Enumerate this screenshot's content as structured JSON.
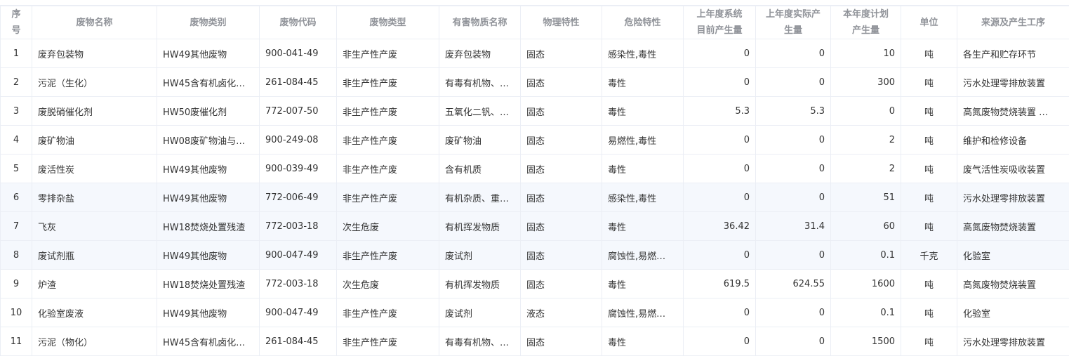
{
  "table": {
    "columns": [
      "序\n号",
      "废物名称",
      "废物类别",
      "废物代码",
      "废物类型",
      "有害物质名称",
      "物理特性",
      "危险特性",
      "上年度系统\n目前产生量",
      "上年度实际产\n生量",
      "本年度计划\n产生量",
      "单位",
      "来源及产生工序"
    ],
    "rows": [
      [
        "1",
        "废弃包装物",
        "HW49其他废物",
        "900-041-49",
        "非生产性产废",
        "废弃包装物",
        "固态",
        "感染性,毒性",
        "0",
        "0",
        "10",
        "吨",
        "各生产和贮存环节"
      ],
      [
        "2",
        "污泥（生化）",
        "HW45含有机卤化…",
        "261-084-45",
        "非生产性产废",
        "有毒有机物、…",
        "固态",
        "毒性",
        "0",
        "0",
        "300",
        "吨",
        "污水处理零排放装置"
      ],
      [
        "3",
        "废脱硝催化剂",
        "HW50废催化剂",
        "772-007-50",
        "非生产性产废",
        "五氧化二钒、…",
        "固态",
        "毒性",
        "5.3",
        "5.3",
        "0",
        "吨",
        "高氮废物焚烧装置 …"
      ],
      [
        "4",
        "废矿物油",
        "HW08废矿物油与…",
        "900-249-08",
        "非生产性产废",
        "废矿物油",
        "固态",
        "易燃性,毒性",
        "0",
        "0",
        "2",
        "吨",
        "维护和检修设备"
      ],
      [
        "5",
        "废活性炭",
        "HW49其他废物",
        "900-039-49",
        "非生产性产废",
        "含有机质",
        "固态",
        "毒性",
        "0",
        "0",
        "2",
        "吨",
        "废气活性炭吸收装置"
      ],
      [
        "6",
        "零排杂盐",
        "HW49其他废物",
        "772-006-49",
        "非生产性产废",
        "有机杂质、重…",
        "固态",
        "感染性,毒性",
        "0",
        "0",
        "51",
        "吨",
        "污水处理零排放装置"
      ],
      [
        "7",
        "飞灰",
        "HW18焚烧处置残渣",
        "772-003-18",
        "次生危废",
        "有机挥发物质",
        "固态",
        "毒性",
        "36.42",
        "31.4",
        "60",
        "吨",
        "高氮废物焚烧装置"
      ],
      [
        "8",
        "废试剂瓶",
        "HW49其他废物",
        "900-047-49",
        "非生产性产废",
        "废试剂",
        "固态",
        "腐蚀性,易燃…",
        "0",
        "0",
        "0.1",
        "千克",
        "化验室"
      ],
      [
        "9",
        "炉渣",
        "HW18焚烧处置残渣",
        "772-003-18",
        "次生危废",
        "有机挥发物质",
        "固态",
        "毒性",
        "619.5",
        "624.55",
        "1600",
        "吨",
        "高氮废物焚烧装置"
      ],
      [
        "10",
        "化验室废液",
        "HW49其他废物",
        "900-047-49",
        "非生产性产废",
        "废试剂",
        "液态",
        "腐蚀性,易燃…",
        "0",
        "0",
        "0.1",
        "吨",
        "化验室"
      ],
      [
        "11",
        "污泥（物化）",
        "HW45含有机卤化…",
        "261-084-45",
        "非生产性产废",
        "有毒有机物、…",
        "固态",
        "毒性",
        "0",
        "0",
        "1500",
        "吨",
        "污水处理零排放装置"
      ]
    ]
  }
}
